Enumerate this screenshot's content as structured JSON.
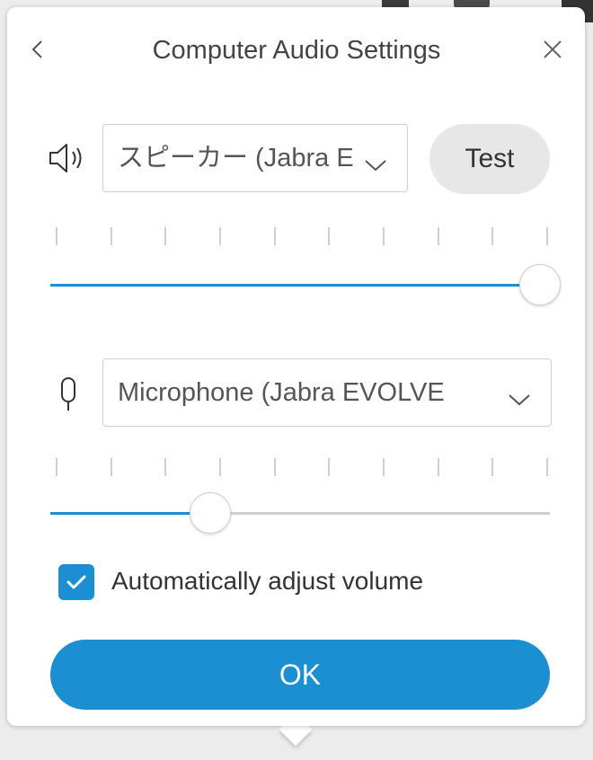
{
  "dialog": {
    "title": "Computer Audio Settings",
    "back_icon": "chevron-left-icon",
    "close_icon": "close-icon"
  },
  "speaker": {
    "icon": "speaker-icon",
    "device": "スピーカー (Jabra E",
    "test_label": "Test",
    "volume": 0.98
  },
  "microphone": {
    "icon": "microphone-icon",
    "device": "Microphone (Jabra EVOLVE",
    "volume": 0.32
  },
  "auto_adjust": {
    "checked": true,
    "label": "Automatically adjust volume"
  },
  "ok_label": "OK",
  "colors": {
    "accent": "#1b8fd1",
    "test_button_bg": "#e7e7e7"
  }
}
